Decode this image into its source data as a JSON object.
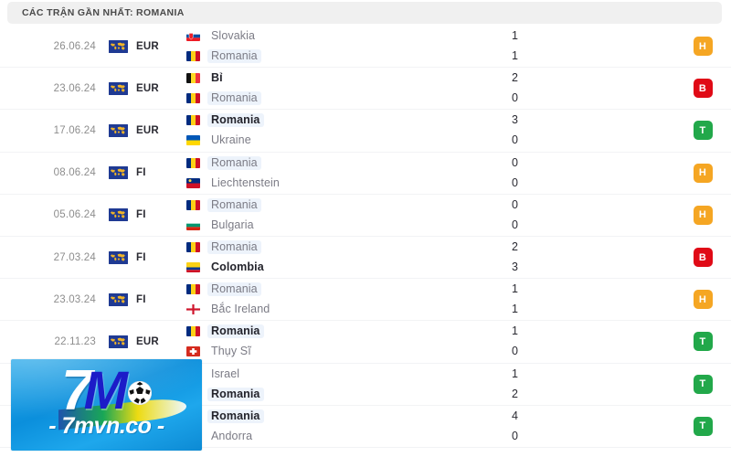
{
  "header": {
    "title": "CÁC TRẬN GẦN NHẤT: ROMANIA"
  },
  "colors": {
    "win": "#22a84a",
    "draw": "#f5a623",
    "loss": "#e00a16",
    "header_bg": "#f0f0f0",
    "highlight": "#edf3fb",
    "date_text": "#8d8d8d",
    "team_text": "#7b7b85",
    "team_text_bold": "#23232b"
  },
  "result_legend": {
    "win": "T",
    "draw": "H",
    "loss": "B"
  },
  "matches": [
    {
      "date": "26.06.24",
      "competition": "EUR",
      "competition_icon": "world-map-icon",
      "home": {
        "team": "Slovakia",
        "flag": "flag-slovakia",
        "score": "1",
        "bold": false,
        "highlight": false
      },
      "away": {
        "team": "Romania",
        "flag": "flag-romania",
        "score": "1",
        "bold": false,
        "highlight": true
      },
      "result": "H"
    },
    {
      "date": "23.06.24",
      "competition": "EUR",
      "competition_icon": "world-map-icon",
      "home": {
        "team": "Bỉ",
        "flag": "flag-belgium",
        "score": "2",
        "bold": true,
        "highlight": false
      },
      "away": {
        "team": "Romania",
        "flag": "flag-romania",
        "score": "0",
        "bold": false,
        "highlight": true
      },
      "result": "B"
    },
    {
      "date": "17.06.24",
      "competition": "EUR",
      "competition_icon": "world-map-icon",
      "home": {
        "team": "Romania",
        "flag": "flag-romania",
        "score": "3",
        "bold": true,
        "highlight": true
      },
      "away": {
        "team": "Ukraine",
        "flag": "flag-ukraine",
        "score": "0",
        "bold": false,
        "highlight": false
      },
      "result": "T"
    },
    {
      "date": "08.06.24",
      "competition": "FI",
      "competition_icon": "world-map-icon",
      "home": {
        "team": "Romania",
        "flag": "flag-romania",
        "score": "0",
        "bold": false,
        "highlight": true
      },
      "away": {
        "team": "Liechtenstein",
        "flag": "flag-liechtenstein",
        "score": "0",
        "bold": false,
        "highlight": false
      },
      "result": "H"
    },
    {
      "date": "05.06.24",
      "competition": "FI",
      "competition_icon": "world-map-icon",
      "home": {
        "team": "Romania",
        "flag": "flag-romania",
        "score": "0",
        "bold": false,
        "highlight": true
      },
      "away": {
        "team": "Bulgaria",
        "flag": "flag-bulgaria",
        "score": "0",
        "bold": false,
        "highlight": false
      },
      "result": "H"
    },
    {
      "date": "27.03.24",
      "competition": "FI",
      "competition_icon": "world-map-icon",
      "home": {
        "team": "Romania",
        "flag": "flag-romania",
        "score": "2",
        "bold": false,
        "highlight": true
      },
      "away": {
        "team": "Colombia",
        "flag": "flag-colombia",
        "score": "3",
        "bold": true,
        "highlight": false
      },
      "result": "B"
    },
    {
      "date": "23.03.24",
      "competition": "FI",
      "competition_icon": "world-map-icon",
      "home": {
        "team": "Romania",
        "flag": "flag-romania",
        "score": "1",
        "bold": false,
        "highlight": true
      },
      "away": {
        "team": "Bắc Ireland",
        "flag": "flag-northern-ireland",
        "score": "1",
        "bold": false,
        "highlight": false
      },
      "result": "H"
    },
    {
      "date": "22.11.23",
      "competition": "EUR",
      "competition_icon": "world-map-icon",
      "home": {
        "team": "Romania",
        "flag": "flag-romania",
        "score": "1",
        "bold": true,
        "highlight": true
      },
      "away": {
        "team": "Thụy Sĩ",
        "flag": "flag-switzerland",
        "score": "0",
        "bold": false,
        "highlight": false
      },
      "result": "T"
    },
    {
      "date": "",
      "competition": "",
      "competition_icon": "world-map-icon",
      "home": {
        "team": "Israel",
        "flag": "flag-israel",
        "score": "1",
        "bold": false,
        "highlight": false
      },
      "away": {
        "team": "Romania",
        "flag": "flag-romania",
        "score": "2",
        "bold": true,
        "highlight": true
      },
      "result": "T"
    },
    {
      "date": "",
      "competition": "",
      "competition_icon": "world-map-icon",
      "home": {
        "team": "Romania",
        "flag": "flag-romania",
        "score": "4",
        "bold": true,
        "highlight": true
      },
      "away": {
        "team": "Andorra",
        "flag": "flag-andorra",
        "score": "0",
        "bold": false,
        "highlight": false
      },
      "result": "T"
    }
  ],
  "watermark": {
    "brand_number": "7",
    "brand_letter": "M",
    "url": "- 7mvn.co -"
  }
}
